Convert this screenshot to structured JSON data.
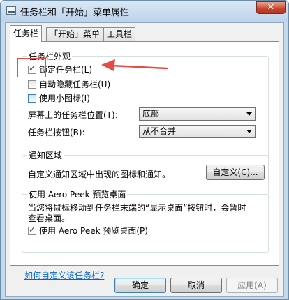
{
  "window": {
    "title": "任务栏和「开始」菜单属性",
    "close_glyph": "✕"
  },
  "tabs": [
    {
      "label": "任务栏"
    },
    {
      "label": "「开始」菜单"
    },
    {
      "label": "工具栏"
    }
  ],
  "appearance": {
    "label": "任务栏外观",
    "lock_taskbar": {
      "label": "锁定任务栏(L)",
      "checked": true
    },
    "auto_hide": {
      "label": "自动隐藏任务栏(U)",
      "checked": false
    },
    "small_icons": {
      "label": "使用小图标(I)",
      "checked": false
    },
    "position_label": "屏幕上的任务栏位置(T):",
    "position_value": "底部",
    "buttons_label": "任务栏按钮(B):",
    "buttons_value": "从不合并"
  },
  "notification": {
    "label": "通知区域",
    "description": "自定义通知区域中出现的图标和通知。",
    "customize_button": "自定义(C)..."
  },
  "aero_peek": {
    "label": "使用 Aero Peek 预览桌面",
    "description_line1": "当您将鼠标移动到任务栏末端的“显示桌面”按钮时，会暂时",
    "description_line2": "查看桌面。",
    "checkbox": {
      "label": "使用 Aero Peek 预览桌面(P)",
      "checked": true
    }
  },
  "help_link": "如何自定义该任务栏?",
  "footer": {
    "ok": "确定",
    "cancel": "取消",
    "apply": "应用(A)"
  },
  "annotation": {
    "color": "#e84a44"
  }
}
